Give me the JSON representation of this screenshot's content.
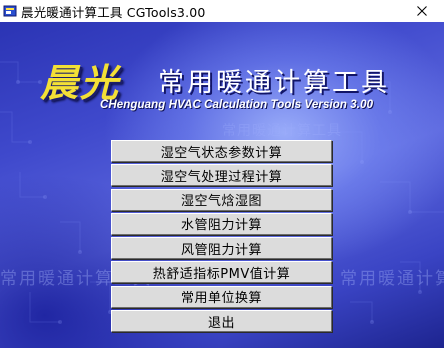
{
  "window": {
    "title": "晨光暖通计算工具 CGTools3.00",
    "close_icon": "close-icon"
  },
  "splash": {
    "logo": "晨光",
    "title": "常用暖通计算工具",
    "subtitle": "CHenguang HVAC Calculation Tools   Version 3.00"
  },
  "menu": {
    "items": [
      {
        "label": "湿空气状态参数计算"
      },
      {
        "label": "湿空气处理过程计算"
      },
      {
        "label": "湿空气焓湿图"
      },
      {
        "label": "水管阻力计算"
      },
      {
        "label": "风管阻力计算"
      },
      {
        "label": "热舒适指标PMV值计算"
      },
      {
        "label": "常用单位换算"
      },
      {
        "label": "退出"
      }
    ]
  },
  "theme": {
    "background_blue": "#3f49cc",
    "logo_yellow": "#f3e036",
    "button_face": "#dcdcdc"
  }
}
